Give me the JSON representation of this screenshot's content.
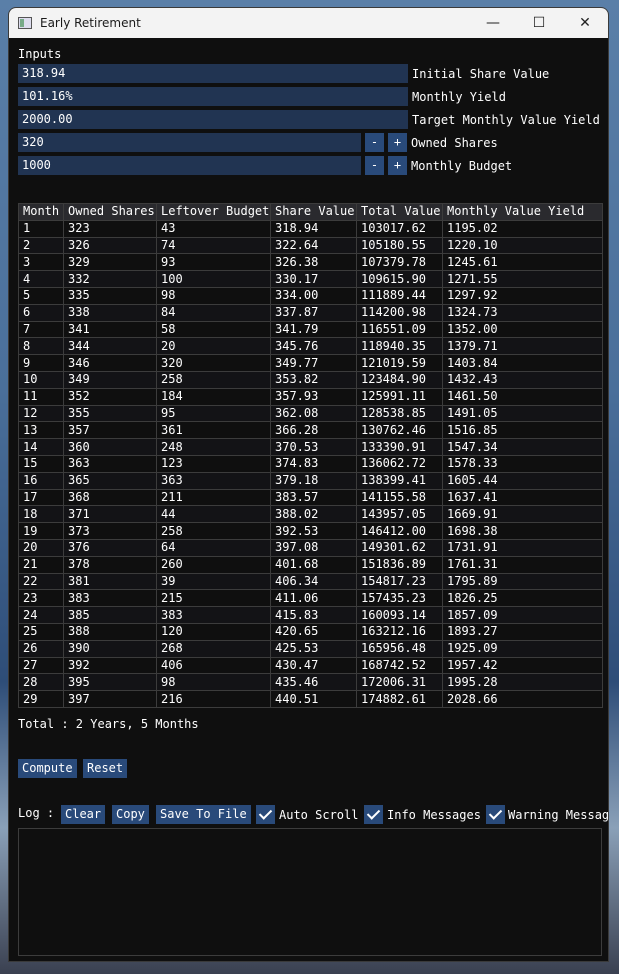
{
  "window": {
    "title": "Early Retirement",
    "minimize": "—",
    "maximize": "☐",
    "close": "✕"
  },
  "inputs": {
    "section_label": "Inputs",
    "initial_share_value": {
      "value": "318.94",
      "label": "Initial Share Value"
    },
    "monthly_yield": {
      "value": "101.16%",
      "label": "Monthly Yield"
    },
    "target_yield": {
      "value": "2000.00",
      "label": "Target Monthly Value Yield"
    },
    "owned_shares": {
      "value": "320",
      "label": "Owned Shares",
      "minus": "-",
      "plus": "+"
    },
    "monthly_budget": {
      "value": "1000",
      "label": "Monthly Budget",
      "minus": "-",
      "plus": "+"
    }
  },
  "table": {
    "headers": [
      "Month",
      "Owned Shares",
      "Leftover Budget",
      "Share Value",
      "Total Value",
      "Monthly Value Yield"
    ],
    "rows": [
      [
        "1",
        "323",
        "43",
        "318.94",
        "103017.62",
        "1195.02"
      ],
      [
        "2",
        "326",
        "74",
        "322.64",
        "105180.55",
        "1220.10"
      ],
      [
        "3",
        "329",
        "93",
        "326.38",
        "107379.78",
        "1245.61"
      ],
      [
        "4",
        "332",
        "100",
        "330.17",
        "109615.90",
        "1271.55"
      ],
      [
        "5",
        "335",
        "98",
        "334.00",
        "111889.44",
        "1297.92"
      ],
      [
        "6",
        "338",
        "84",
        "337.87",
        "114200.98",
        "1324.73"
      ],
      [
        "7",
        "341",
        "58",
        "341.79",
        "116551.09",
        "1352.00"
      ],
      [
        "8",
        "344",
        "20",
        "345.76",
        "118940.35",
        "1379.71"
      ],
      [
        "9",
        "346",
        "320",
        "349.77",
        "121019.59",
        "1403.84"
      ],
      [
        "10",
        "349",
        "258",
        "353.82",
        "123484.90",
        "1432.43"
      ],
      [
        "11",
        "352",
        "184",
        "357.93",
        "125991.11",
        "1461.50"
      ],
      [
        "12",
        "355",
        "95",
        "362.08",
        "128538.85",
        "1491.05"
      ],
      [
        "13",
        "357",
        "361",
        "366.28",
        "130762.46",
        "1516.85"
      ],
      [
        "14",
        "360",
        "248",
        "370.53",
        "133390.91",
        "1547.34"
      ],
      [
        "15",
        "363",
        "123",
        "374.83",
        "136062.72",
        "1578.33"
      ],
      [
        "16",
        "365",
        "363",
        "379.18",
        "138399.41",
        "1605.44"
      ],
      [
        "17",
        "368",
        "211",
        "383.57",
        "141155.58",
        "1637.41"
      ],
      [
        "18",
        "371",
        "44",
        "388.02",
        "143957.05",
        "1669.91"
      ],
      [
        "19",
        "373",
        "258",
        "392.53",
        "146412.00",
        "1698.38"
      ],
      [
        "20",
        "376",
        "64",
        "397.08",
        "149301.62",
        "1731.91"
      ],
      [
        "21",
        "378",
        "260",
        "401.68",
        "151836.89",
        "1761.31"
      ],
      [
        "22",
        "381",
        "39",
        "406.34",
        "154817.23",
        "1795.89"
      ],
      [
        "23",
        "383",
        "215",
        "411.06",
        "157435.23",
        "1826.25"
      ],
      [
        "24",
        "385",
        "383",
        "415.83",
        "160093.14",
        "1857.09"
      ],
      [
        "25",
        "388",
        "120",
        "420.65",
        "163212.16",
        "1893.27"
      ],
      [
        "26",
        "390",
        "268",
        "425.53",
        "165956.48",
        "1925.09"
      ],
      [
        "27",
        "392",
        "406",
        "430.47",
        "168742.52",
        "1957.42"
      ],
      [
        "28",
        "395",
        "98",
        "435.46",
        "172006.31",
        "1995.28"
      ],
      [
        "29",
        "397",
        "216",
        "440.51",
        "174882.61",
        "2028.66"
      ]
    ]
  },
  "total": "Total : 2 Years, 5 Months",
  "actions": {
    "compute": "Compute",
    "reset": "Reset"
  },
  "log": {
    "label": "Log :",
    "clear": "Clear",
    "copy": "Copy",
    "save": "Save To File",
    "auto_scroll": "Auto Scroll",
    "info_messages": "Info Messages",
    "warning_messages": "Warning Messages"
  },
  "colors": {
    "background": "#0f0f0f",
    "field": "#213452",
    "button": "#294a7a"
  }
}
